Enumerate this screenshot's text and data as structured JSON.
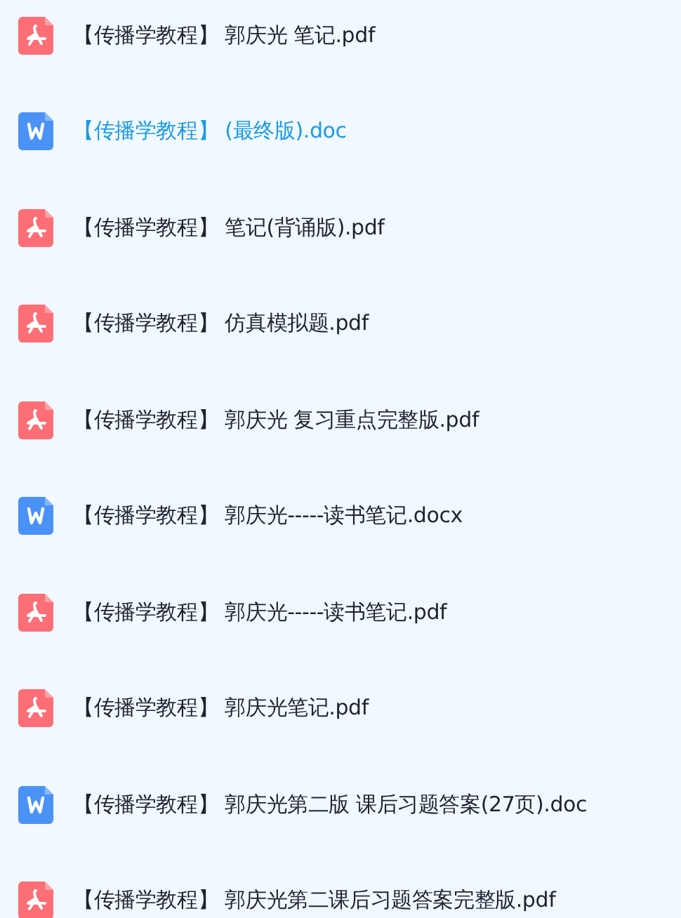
{
  "files": [
    {
      "kind": "pdf",
      "name": "【传播学教程】 郭庆光 笔记.pdf",
      "selected": false
    },
    {
      "kind": "word",
      "name": "【传播学教程】 (最终版).doc",
      "selected": true
    },
    {
      "kind": "pdf",
      "name": "【传播学教程】 笔记(背诵版).pdf",
      "selected": false
    },
    {
      "kind": "pdf",
      "name": "【传播学教程】 仿真模拟题.pdf",
      "selected": false
    },
    {
      "kind": "pdf",
      "name": "【传播学教程】 郭庆光 复习重点完整版.pdf",
      "selected": false
    },
    {
      "kind": "word",
      "name": "【传播学教程】 郭庆光-----读书笔记.docx",
      "selected": false
    },
    {
      "kind": "pdf",
      "name": "【传播学教程】 郭庆光-----读书笔记.pdf",
      "selected": false
    },
    {
      "kind": "pdf",
      "name": "【传播学教程】 郭庆光笔记.pdf",
      "selected": false
    },
    {
      "kind": "word",
      "name": "【传播学教程】 郭庆光第二版 课后习题答案(27页).doc",
      "selected": false
    },
    {
      "kind": "pdf",
      "name": "【传播学教程】 郭庆光第二课后习题答案完整版.pdf",
      "selected": false
    }
  ]
}
